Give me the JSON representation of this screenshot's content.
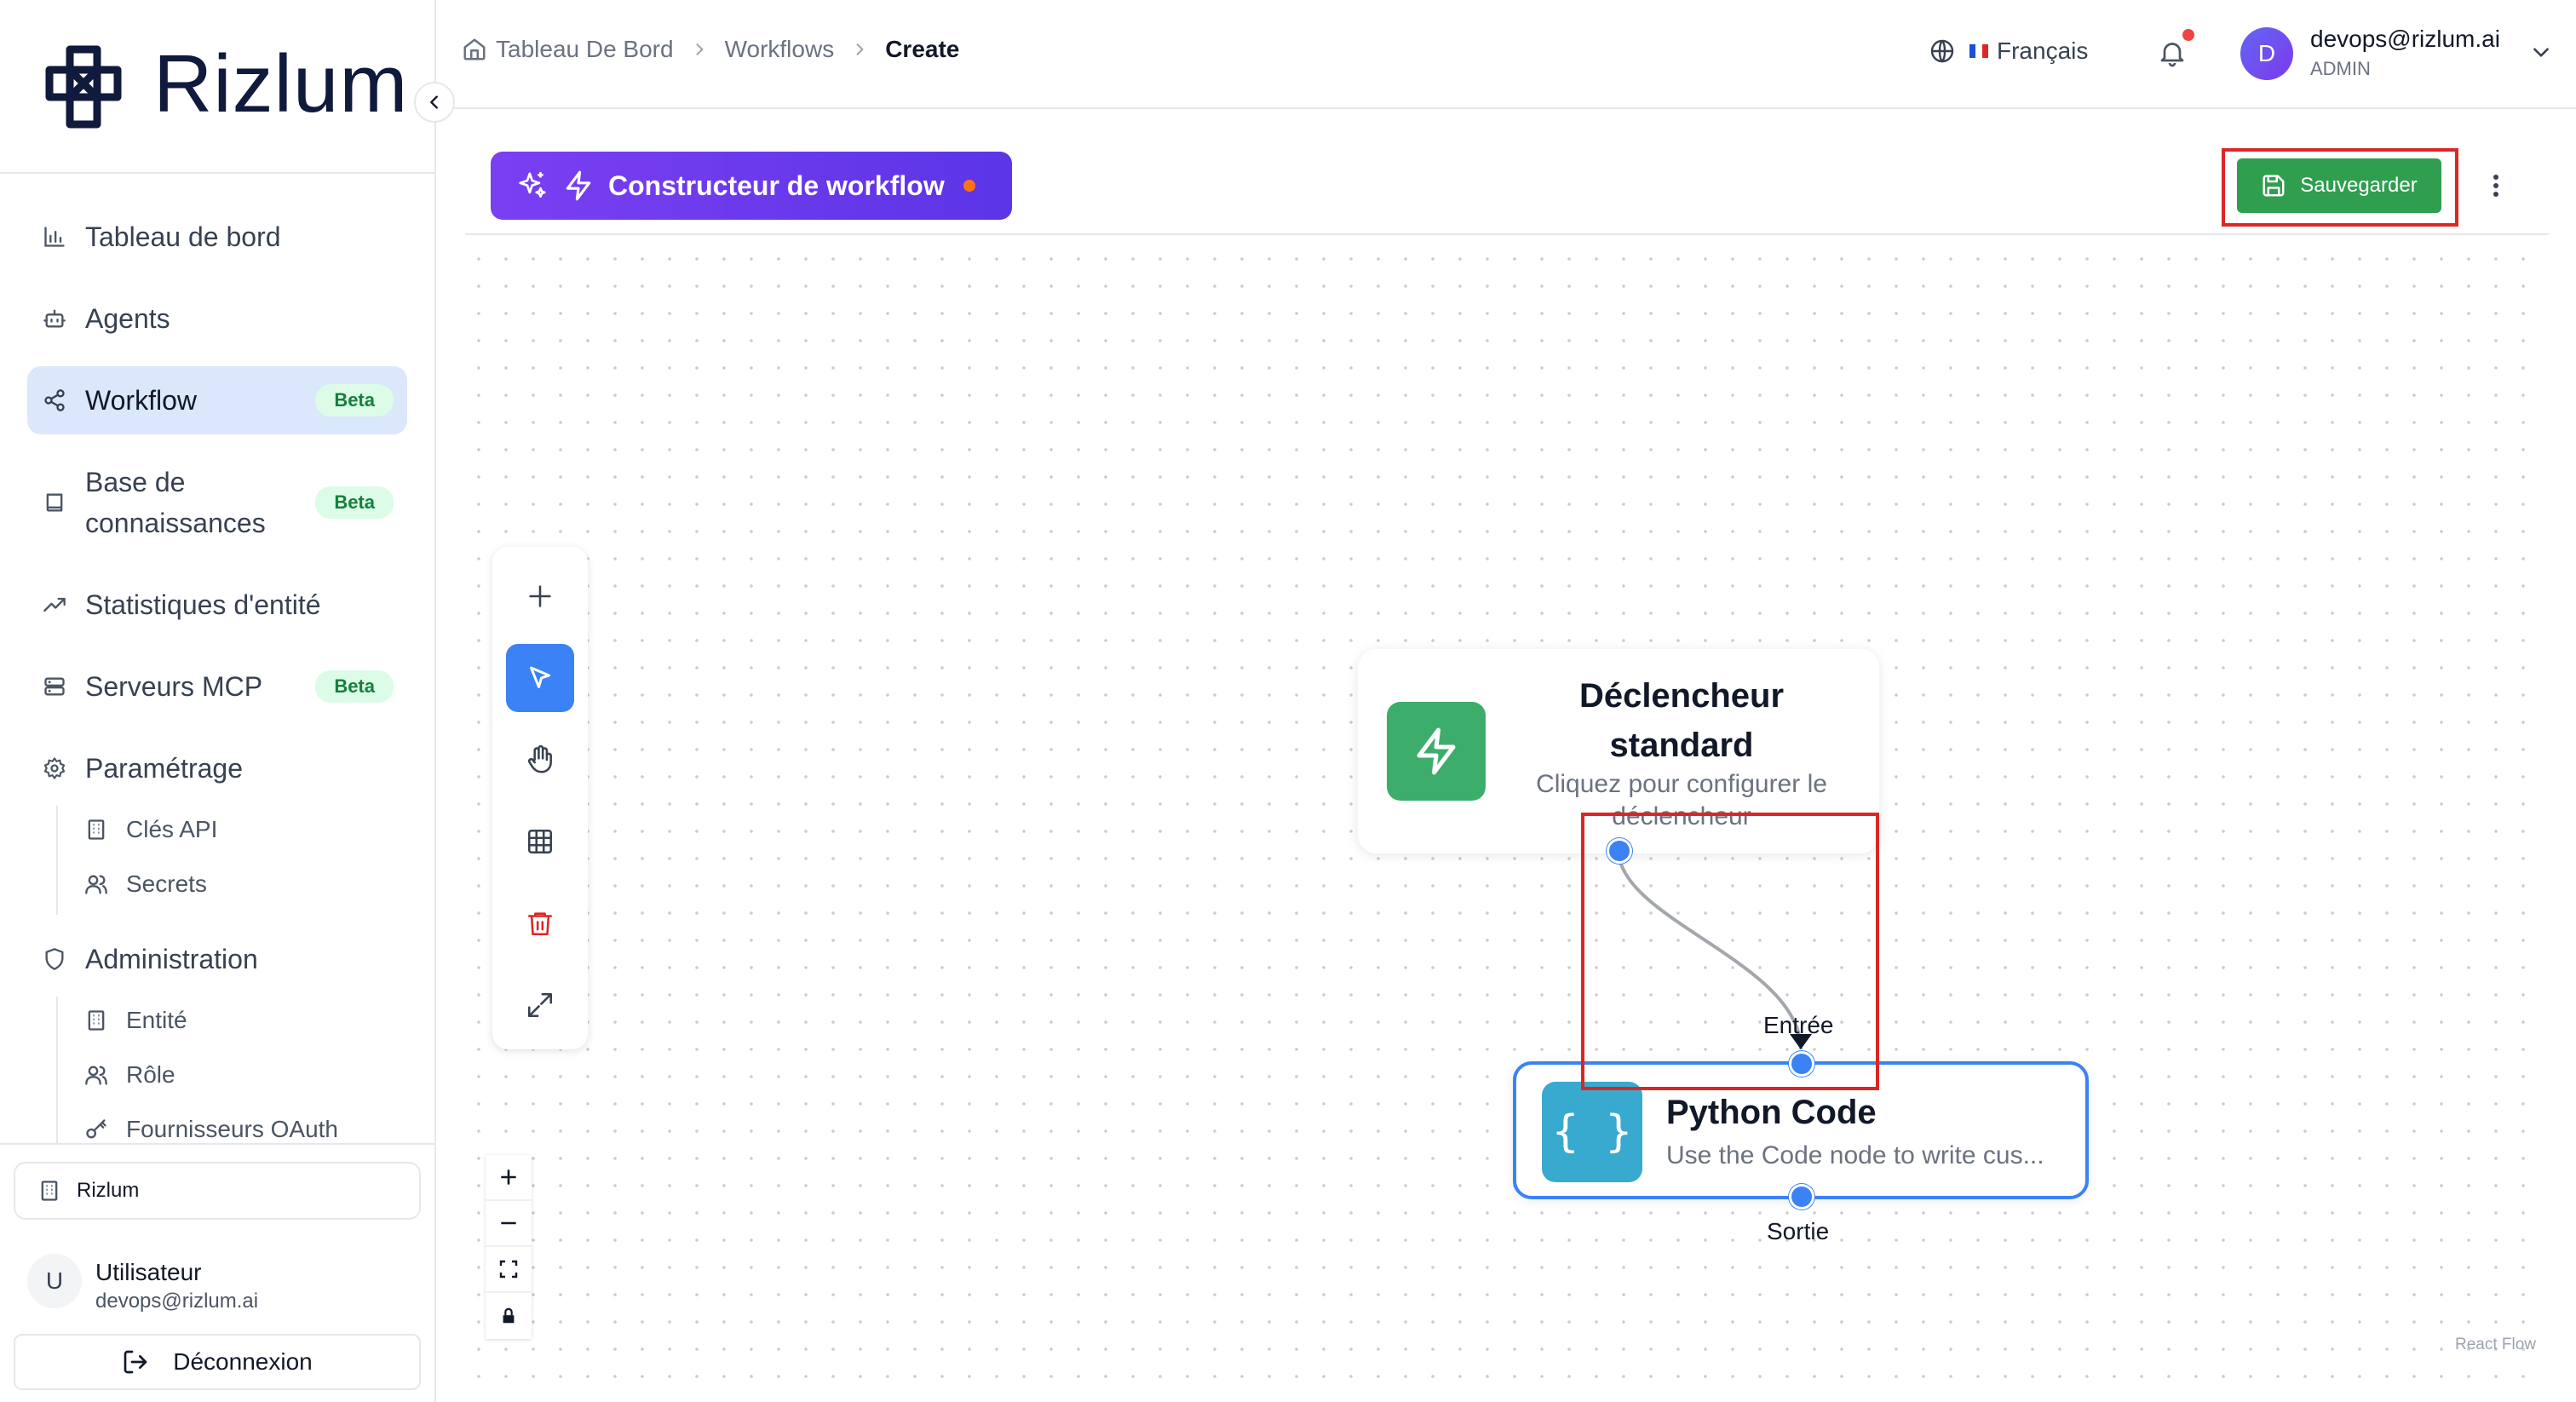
{
  "brand": {
    "name": "Rizlum"
  },
  "sidebar": {
    "items": [
      {
        "label": "Tableau de bord",
        "icon": "bar-chart-icon"
      },
      {
        "label": "Agents",
        "icon": "bot-icon"
      },
      {
        "label": "Workflow",
        "icon": "share-nodes-icon",
        "badge": "Beta",
        "active": true
      },
      {
        "label": "Base de connaissances",
        "icon": "book-icon",
        "badge": "Beta"
      },
      {
        "label": "Statistiques d'entité",
        "icon": "trending-up-icon"
      },
      {
        "label": "Serveurs MCP",
        "icon": "server-icon",
        "badge": "Beta"
      },
      {
        "label": "Paramétrage",
        "icon": "gear-icon"
      },
      {
        "label": "Administration",
        "icon": "shield-icon"
      }
    ],
    "settings_children": [
      {
        "label": "Clés API",
        "icon": "building-icon"
      },
      {
        "label": "Secrets",
        "icon": "users-icon"
      }
    ],
    "admin_children": [
      {
        "label": "Entité",
        "icon": "building-icon"
      },
      {
        "label": "Rôle",
        "icon": "users-icon"
      },
      {
        "label": "Fournisseurs OAuth",
        "icon": "key-icon"
      }
    ],
    "org": "Rizlum",
    "user": {
      "initial": "U",
      "name": "Utilisateur",
      "email": "devops@rizlum.ai"
    },
    "logout_label": "Déconnexion"
  },
  "header": {
    "breadcrumb": [
      "Tableau De Bord",
      "Workflows",
      "Create"
    ],
    "language": "Français",
    "user": {
      "initial": "D",
      "email": "devops@rizlum.ai",
      "role": "ADMIN"
    }
  },
  "builder": {
    "title": "Constructeur de workflow",
    "save_label": "Sauvegarder"
  },
  "nodes": {
    "trigger": {
      "title": "Déclencheur standard",
      "description": "Cliquez pour configurer le déclencheur"
    },
    "code": {
      "icon_text": "{ }",
      "title": "Python Code",
      "description": "Use the Code node to write cus...",
      "input_label": "Entrée",
      "output_label": "Sortie"
    }
  },
  "canvas": {
    "attribution": "React Flow"
  },
  "colors": {
    "accent_blue": "#3b82f6",
    "builder_purple": "#6d3cf0",
    "save_green": "#2f9e4f",
    "trigger_green": "#3dad6c",
    "code_cyan": "#38a9cf",
    "highlight_red": "#dc2626",
    "badge_green": "#15803d"
  }
}
